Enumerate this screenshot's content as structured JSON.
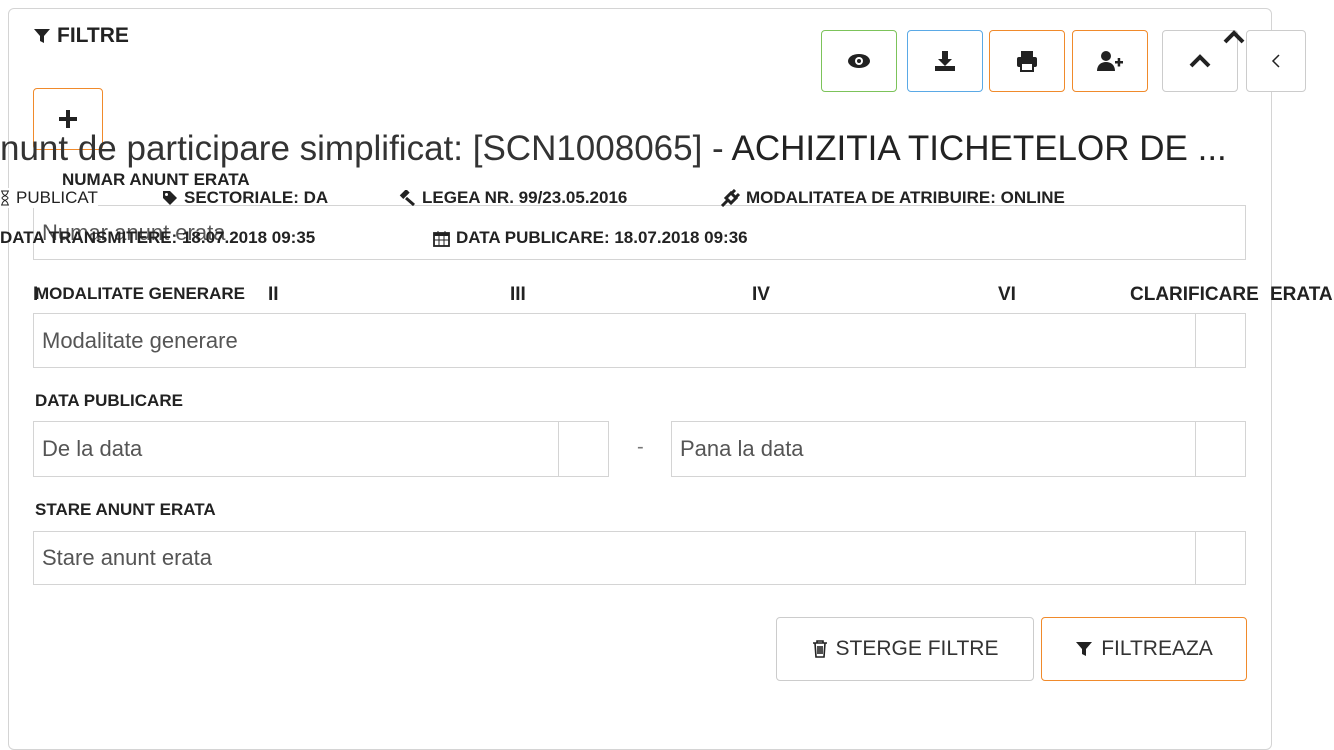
{
  "filters": {
    "title": "FILTRE",
    "numar_label": "NUMAR ANUNT ERATA",
    "numar_placeholder": "Numar anunt erata",
    "modalitate_label": "MODALITATE GENERARE",
    "modalitate_placeholder": "Modalitate generare",
    "data_label": "DATA PUBLICARE",
    "de_la_placeholder": "De la data",
    "separator": "-",
    "pana_la_placeholder": "Pana la data",
    "stare_label": "STARE ANUNT ERATA",
    "stare_placeholder": "Stare anunt erata",
    "clear_label": "STERGE FILTRE",
    "apply_label": "FILTREAZA"
  },
  "toolbar": {
    "icons": [
      "eye-icon",
      "download-icon",
      "print-icon",
      "add-user-icon",
      "chevron-up-icon",
      "chevron-left-icon"
    ],
    "colors": {
      "view": "#7cc35a",
      "download": "#5aa9e6",
      "print": "#f08a2b",
      "add_user": "#f08a2b",
      "default": "#cccccc"
    }
  },
  "notice": {
    "title_prefix": "nunt de participare simplificat: [SCN1008065] - ",
    "title_strong": "ACHIZITIA TICHETELOR DE ...",
    "status": "PUBLICAT",
    "sectoriale": "SECTORIALE: DA",
    "legea": "LEGEA NR. 99/23.05.2016",
    "modalitate": "MODALITATEA DE ATRIBUIRE: ONLINE",
    "data_transmitere": "DATA TRANSMITERE: 18.07.2018 09:35",
    "data_publicare": "DATA PUBLICARE: 18.07.2018 09:36"
  },
  "tabs": [
    "I",
    "II",
    "III",
    "IV",
    "VI",
    "CLARIFICARE",
    "ERATA"
  ],
  "accent": "#f08a2b"
}
